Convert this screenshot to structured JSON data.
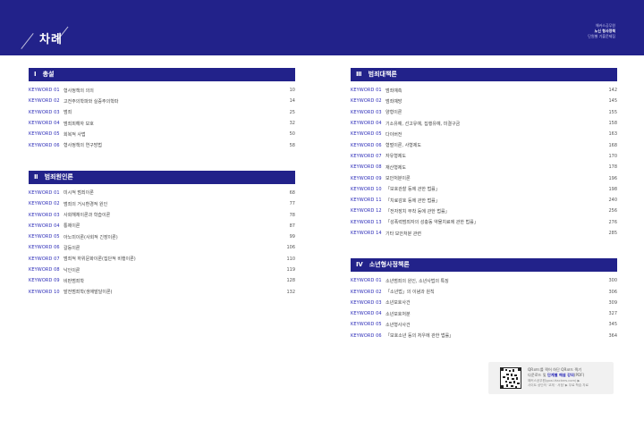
{
  "header": {
    "title": "차례",
    "info_line1": "해커스공무원",
    "info_line2": "노신 형사정책",
    "info_line3": "단원별 기출문제집"
  },
  "left_sections": [
    {
      "num": "Ⅰ",
      "title": "총설",
      "items": [
        {
          "kw": "KEYWORD 01",
          "label": "형사정책의 의의",
          "page": "10"
        },
        {
          "kw": "KEYWORD 02",
          "label": "고전주의학파와 실증주의학파",
          "page": "14"
        },
        {
          "kw": "KEYWORD 03",
          "label": "범죄",
          "page": "25"
        },
        {
          "kw": "KEYWORD 04",
          "label": "범죄피해자 보호",
          "page": "32"
        },
        {
          "kw": "KEYWORD 05",
          "label": "회복적 사법",
          "page": "50"
        },
        {
          "kw": "KEYWORD 06",
          "label": "형사정책의 연구방법",
          "page": "58"
        }
      ]
    },
    {
      "num": "Ⅱ",
      "title": "범죄원인론",
      "items": [
        {
          "kw": "KEYWORD 01",
          "label": "미시적 범죄이론",
          "page": "68"
        },
        {
          "kw": "KEYWORD 02",
          "label": "범죄의 거시환경적 원인",
          "page": "77"
        },
        {
          "kw": "KEYWORD 03",
          "label": "사회해체이론과 학습이론",
          "page": "78"
        },
        {
          "kw": "KEYWORD 04",
          "label": "통제이론",
          "page": "87"
        },
        {
          "kw": "KEYWORD 05",
          "label": "아노미이론(사회적 긴장이론)",
          "page": "99"
        },
        {
          "kw": "KEYWORD 06",
          "label": "갈등이론",
          "page": "106"
        },
        {
          "kw": "KEYWORD 07",
          "label": "범죄적 하위문화이론(집단적 비행이론)",
          "page": "110"
        },
        {
          "kw": "KEYWORD 08",
          "label": "낙인이론",
          "page": "119"
        },
        {
          "kw": "KEYWORD 09",
          "label": "비판범죄학",
          "page": "128"
        },
        {
          "kw": "KEYWORD 10",
          "label": "발전범죄학(생애발달이론)",
          "page": "132"
        }
      ]
    }
  ],
  "right_sections": [
    {
      "num": "Ⅲ",
      "title": "범죄대책론",
      "items": [
        {
          "kw": "KEYWORD 01",
          "label": "범죄예측",
          "page": "142"
        },
        {
          "kw": "KEYWORD 02",
          "label": "범죄예방",
          "page": "145"
        },
        {
          "kw": "KEYWORD 03",
          "label": "양형이론",
          "page": "155"
        },
        {
          "kw": "KEYWORD 04",
          "label": "기소유예, 선고유예, 집행유예, 미결구금",
          "page": "158"
        },
        {
          "kw": "KEYWORD 05",
          "label": "다이버전",
          "page": "163"
        },
        {
          "kw": "KEYWORD 06",
          "label": "형벌이론, 사형제도",
          "page": "168"
        },
        {
          "kw": "KEYWORD 07",
          "label": "자유형제도",
          "page": "170"
        },
        {
          "kw": "KEYWORD 08",
          "label": "재산형제도",
          "page": "178"
        },
        {
          "kw": "KEYWORD 09",
          "label": "보안처분이론",
          "page": "196"
        },
        {
          "kw": "KEYWORD 10",
          "label": "「보호관찰 등에 관한 법률」",
          "page": "198"
        },
        {
          "kw": "KEYWORD 11",
          "label": "「치료감호 등에 관한 법률」",
          "page": "240"
        },
        {
          "kw": "KEYWORD 12",
          "label": "「전자장치 부착 등에 관한 법률」",
          "page": "256"
        },
        {
          "kw": "KEYWORD 13",
          "label": "「성폭력범죄자의 성충동 약물치료에 관한 법률」",
          "page": "276"
        },
        {
          "kw": "KEYWORD 14",
          "label": "기타 보안처분 관련",
          "page": "285"
        }
      ]
    },
    {
      "num": "Ⅳ",
      "title": "소년형사정책론",
      "items": [
        {
          "kw": "KEYWORD 01",
          "label": "소년범죄의 원인, 소년사법의 특징",
          "page": "300"
        },
        {
          "kw": "KEYWORD 02",
          "label": "「소년법」의 이념과 원칙",
          "page": "306"
        },
        {
          "kw": "KEYWORD 03",
          "label": "소년보호사건",
          "page": "309"
        },
        {
          "kw": "KEYWORD 04",
          "label": "소년보호처분",
          "page": "327"
        },
        {
          "kw": "KEYWORD 05",
          "label": "소년형사사건",
          "page": "345"
        },
        {
          "kw": "KEYWORD 06",
          "label": "「보호소년 등의 처우에 관한 법률」",
          "page": "364"
        }
      ]
    }
  ],
  "promo": {
    "line1": "QR코드를 찍어 하단 QR코드 찍기",
    "line2_pre": "다운로드 및 ",
    "line2_hl": "단계별 해설 강의",
    "line2_post": "(PDF)",
    "line3": "해커스공무원(gosi.Hackers.com) ▶",
    "line4": "사이트 상단의 '교재 · 서점' ▶ 무료 학습 자료"
  },
  "colors": {
    "accent": "#22228a",
    "keyword": "#2b2bb8"
  }
}
